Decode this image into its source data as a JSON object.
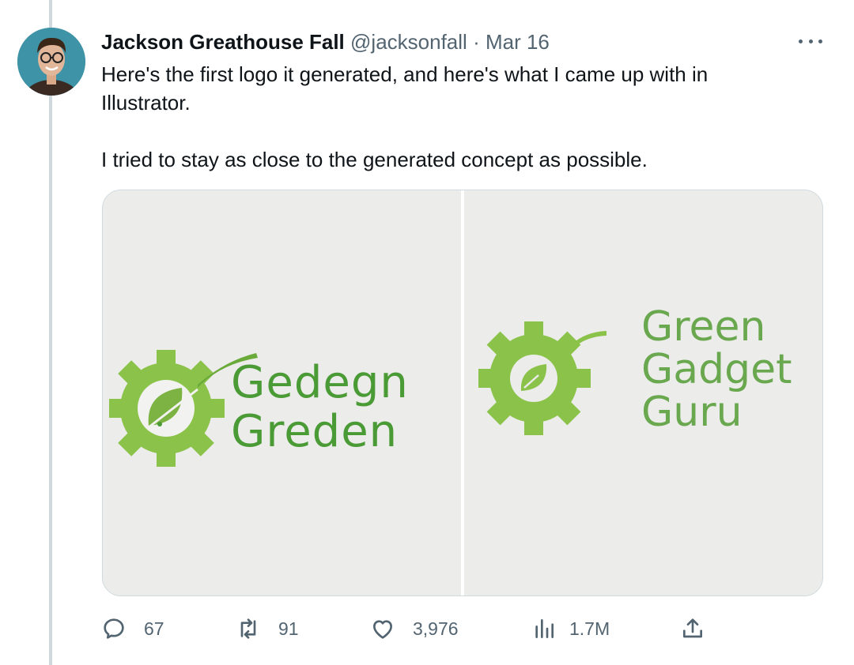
{
  "tweet": {
    "author_name": "Jackson Greathouse Fall",
    "handle": "@jacksonfall",
    "separator": "·",
    "date": "Mar 16",
    "text_line1": "Here's the first logo it generated, and here's what I came up with in Illustrator.",
    "text_line2": "I tried to stay as close to the generated concept as possible."
  },
  "media": {
    "left_logo": {
      "line1": "Gedegn",
      "line2": "Greden"
    },
    "right_logo": {
      "line1": "Green",
      "line2": "Gadget",
      "line3": "Guru"
    }
  },
  "actions": {
    "replies": "67",
    "retweets": "91",
    "likes": "3,976",
    "views": "1.7M"
  },
  "icons": {
    "more": "more-icon",
    "reply": "reply-icon",
    "retweet": "retweet-icon",
    "like": "heart-icon",
    "views": "views-icon",
    "share": "share-icon"
  },
  "colors": {
    "text_primary": "#0f1419",
    "text_secondary": "#536471",
    "logo_green_dark": "#4a9b35",
    "logo_green_light": "#8bc34a"
  }
}
